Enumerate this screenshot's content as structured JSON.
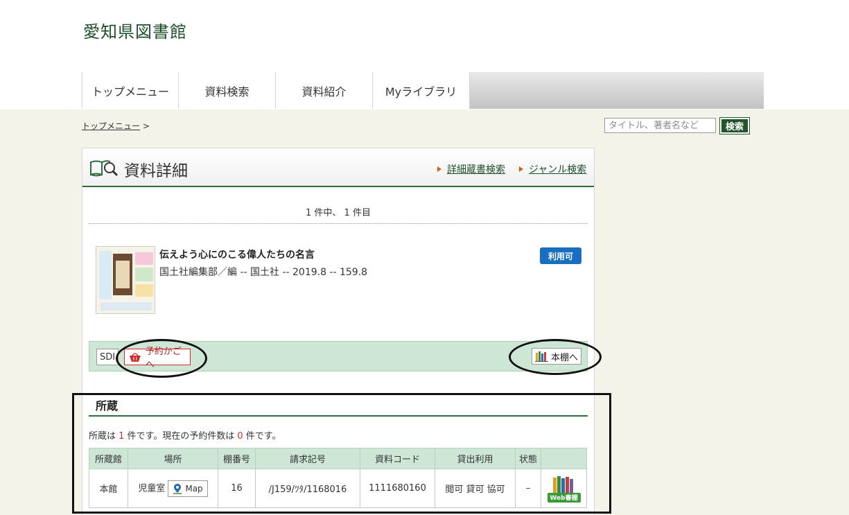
{
  "site": {
    "title": "愛知県図書館"
  },
  "nav": {
    "items": [
      {
        "label": "トップメニュー"
      },
      {
        "label": "資料検索"
      },
      {
        "label": "資料紹介"
      },
      {
        "label": "Myライブラリ"
      }
    ]
  },
  "breadcrumb": {
    "top_link": "トップメニュー",
    "separator": ">"
  },
  "search": {
    "placeholder": "タイトル、著者名など",
    "button_label": "検索"
  },
  "panel": {
    "title": "資料詳細",
    "links": [
      "詳細蔵書検索",
      "ジャンル検索"
    ],
    "result_count": "1 件中、 1 件目"
  },
  "book": {
    "title": "伝えよう心にのこる偉人たちの名言",
    "meta": "国土社編集部／編 -- 国土社 -- 2019.8 -- 159.8",
    "status": "利用可"
  },
  "actions": {
    "sdi": "SDI",
    "cart": "予約かごへ",
    "shelf": "本棚へ"
  },
  "holdings": {
    "title": "所蔵",
    "summary_prefix": "所蔵は ",
    "count": "1",
    "summary_mid": " 件です。現在の予約件数は ",
    "reservations": "0",
    "summary_suffix": " 件です。",
    "columns": [
      "所蔵館",
      "場所",
      "棚番号",
      "請求記号",
      "資料コード",
      "貸出利用",
      "状態",
      ""
    ],
    "rows": [
      {
        "library": "本館",
        "location": "児童室",
        "map_label": "Map",
        "shelf": "16",
        "call_number": "/J159/ﾂﾀ/1168016",
        "item_code": "1111680160",
        "loan": "閲可 貸可 協可",
        "state": "–",
        "web_shelf_label": "Web書棚"
      }
    ]
  },
  "colors": {
    "accent_green": "#2f6b40",
    "status_blue": "#1a6ec0",
    "cart_red": "#cf2a2a"
  }
}
